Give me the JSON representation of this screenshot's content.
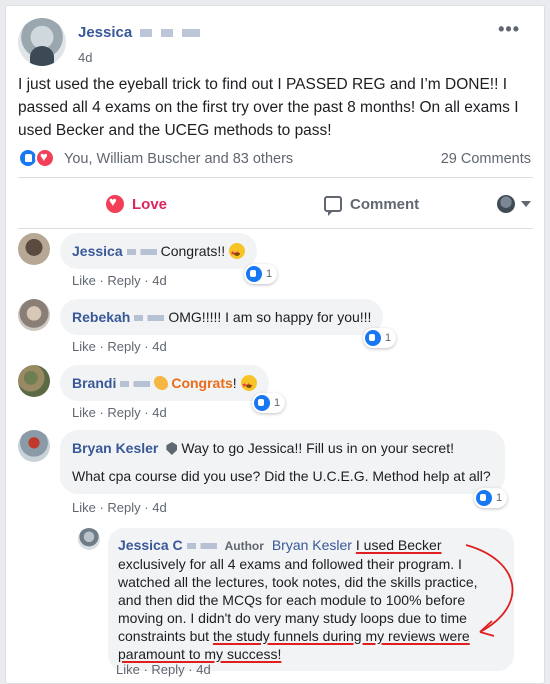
{
  "post": {
    "author": "Jessica",
    "time": "4d",
    "more": "•••",
    "text": "I just used the eyeball trick to find out I PASSED REG and I’m DONE!! I passed all 4 exams on the first try over the past 8 months! On all exams I used Becker and the UCEG methods to pass!",
    "reactions_text": "You, William Buscher and 83 others",
    "comments_count": "29 Comments"
  },
  "actions": {
    "love": "Love",
    "comment": "Comment"
  },
  "comments": [
    {
      "name": "Jessica",
      "text": "Congrats!!",
      "meta_like": "Like",
      "meta_reply": "Reply",
      "meta_time": "4d",
      "likes": "1"
    },
    {
      "name": "Rebekah",
      "text": "OMG!!!!! I am so happy for you!!!",
      "meta_like": "Like",
      "meta_reply": "Reply",
      "meta_time": "4d",
      "likes": "1"
    },
    {
      "name": "Brandi",
      "text": "Congrats",
      "text_suffix": "!",
      "meta_like": "Like",
      "meta_reply": "Reply",
      "meta_time": "4d",
      "likes": "1"
    },
    {
      "name": "Bryan Kesler",
      "text": "Way to go Jessica!! Fill us in on your secret!",
      "text2": "What cpa course did you use? Did the U.C.E.G. Method help at all?",
      "meta_like": "Like",
      "meta_reply": "Reply",
      "meta_time": "4d",
      "likes": "1"
    }
  ],
  "reply": {
    "name": "Jessica C",
    "author_tag": "Author",
    "mention": "Bryan Kesler",
    "text_hl1": "I used Becker",
    "text_mid": "exclusively for all 4 exams and followed their program. I watched all the lectures, took notes, did the skills practice, and then did the MCQs for each module to 100% before moving on. I didn't do very many study loops due to time constraints but ",
    "text_hl2": "the study funnels during my reviews were paramount to my success!",
    "meta_like": "Like",
    "meta_reply": "Reply",
    "meta_time": "4d"
  },
  "colors": {
    "link": "#385898",
    "love": "#e0245e",
    "like": "#1877f2",
    "annotation": "#e02020"
  }
}
